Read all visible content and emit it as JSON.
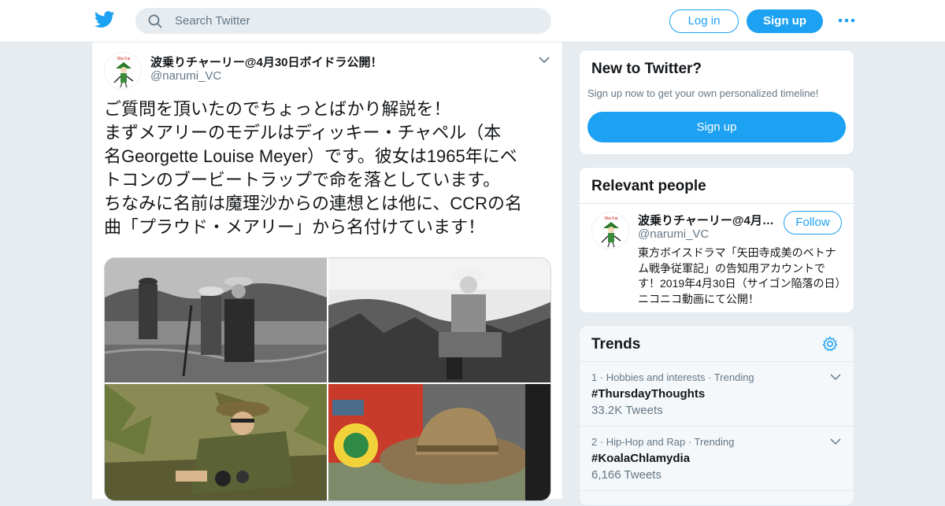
{
  "header": {
    "search_placeholder": "Search Twitter",
    "login_label": "Log in",
    "signup_label": "Sign up",
    "brand_color": "#1da1f2"
  },
  "tweet": {
    "display_name": "波乗りチャーリー@4月30日ボイドラ公開！",
    "handle": "@narumi_VC",
    "text_lines": [
      "ご質問を頂いたのでちょっとばかり解説を！",
      "まずメアリーのモデルはディッキー・チャペル（本",
      "名Georgette Louise Meyer）です。彼女は1965年にベ",
      "トコンのブービートラップで命を落としています。",
      "ちなみに名前は魔理沙からの連想とは他に、CCRの名",
      "曲「プラウド・メアリー」から名付けています！"
    ],
    "media_count": 4
  },
  "sidebar": {
    "new_to_twitter": {
      "title": "New to Twitter?",
      "subtitle": "Sign up now to get your own personalized timeline!",
      "button": "Sign up"
    },
    "relevant_people": {
      "title": "Relevant people",
      "name": "波乗りチャーリー@4月…",
      "handle": "@narumi_VC",
      "follow": "Follow",
      "bio": "東方ボイスドラマ「矢田寺成美のベトナム戦争従軍記」の告知用アカウントです！2019年4月30日（サイゴン陥落の日）ニコニコ動画にて公開！"
    },
    "trends": {
      "title": "Trends",
      "items": [
        {
          "meta": "1 · Hobbies and interests · Trending",
          "tag": "#ThursdayThoughts",
          "count": "33.2K Tweets"
        },
        {
          "meta": "2 · Hip-Hop and Rap · Trending",
          "tag": "#KoalaChlamydia",
          "count": "6,166 Tweets"
        }
      ]
    }
  }
}
